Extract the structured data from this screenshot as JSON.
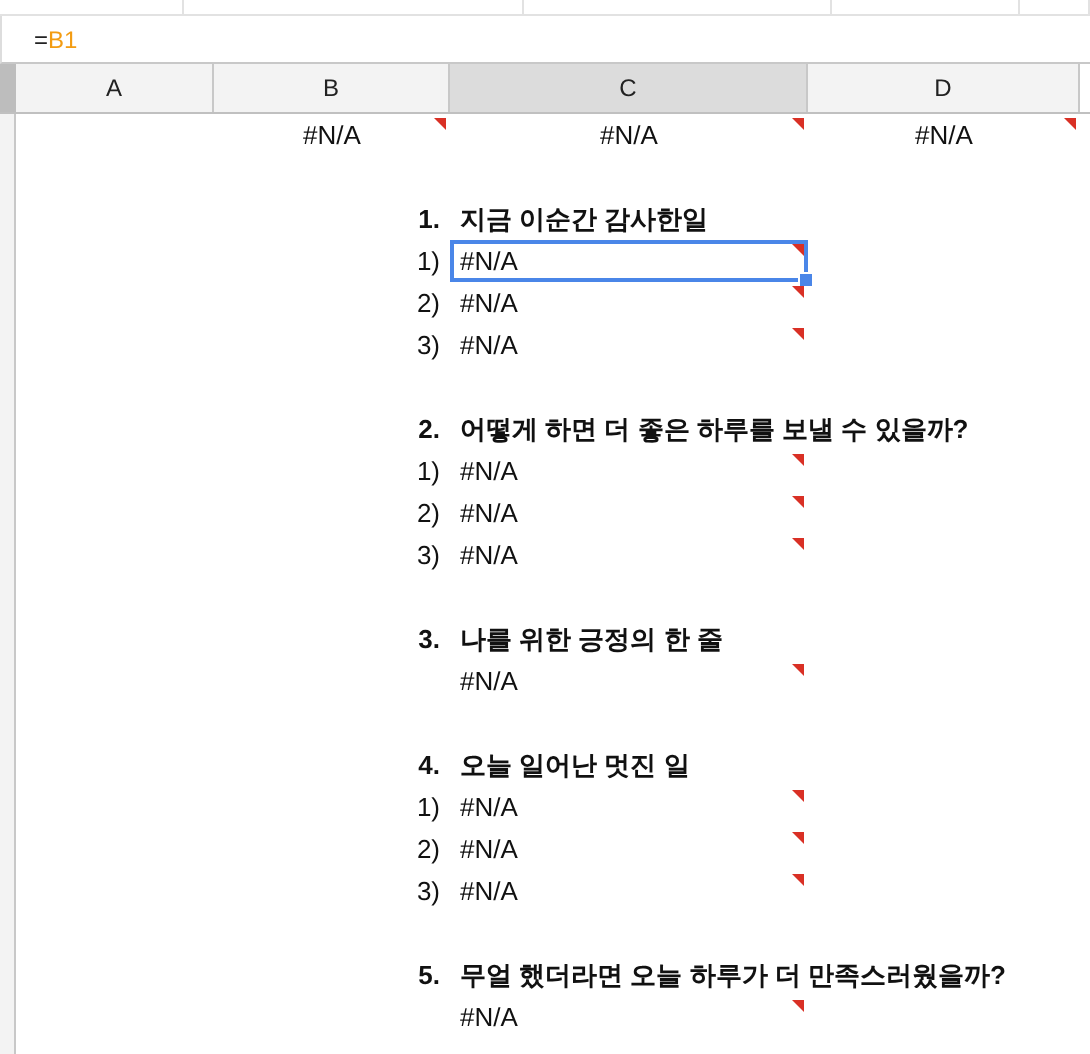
{
  "formula_bar": {
    "prefix": "=",
    "reference": "B1"
  },
  "columns": [
    {
      "label": "A",
      "selected": false
    },
    {
      "label": "B",
      "selected": false
    },
    {
      "label": "C",
      "selected": true
    },
    {
      "label": "D",
      "selected": false
    }
  ],
  "first_row": [
    "#N/A",
    "#N/A",
    "#N/A"
  ],
  "sections": [
    {
      "number": "1.",
      "title": "지금 이순간 감사한일",
      "items": [
        {
          "label": "1)",
          "value": "#N/A",
          "selected": true
        },
        {
          "label": "2)",
          "value": "#N/A",
          "selected": false
        },
        {
          "label": "3)",
          "value": "#N/A",
          "selected": false
        }
      ]
    },
    {
      "number": "2.",
      "title": "어떻게 하면 더 좋은 하루를 보낼 수 있을까?",
      "items": [
        {
          "label": "1)",
          "value": "#N/A",
          "selected": false
        },
        {
          "label": "2)",
          "value": "#N/A",
          "selected": false
        },
        {
          "label": "3)",
          "value": "#N/A",
          "selected": false
        }
      ]
    },
    {
      "number": "3.",
      "title": "나를 위한 긍정의 한 줄",
      "items": [
        {
          "value": "#N/A",
          "selected": false
        }
      ]
    },
    {
      "number": "4.",
      "title": "오늘 일어난 멋진 일",
      "items": [
        {
          "label": "1)",
          "value": "#N/A",
          "selected": false
        },
        {
          "label": "2)",
          "value": "#N/A",
          "selected": false
        },
        {
          "label": "3)",
          "value": "#N/A",
          "selected": false
        }
      ]
    },
    {
      "number": "5.",
      "title": "무얼 했더라면 오늘 하루가 더 만족스러웠을까?",
      "items": [
        {
          "value": "#N/A",
          "selected": false
        }
      ]
    }
  ]
}
